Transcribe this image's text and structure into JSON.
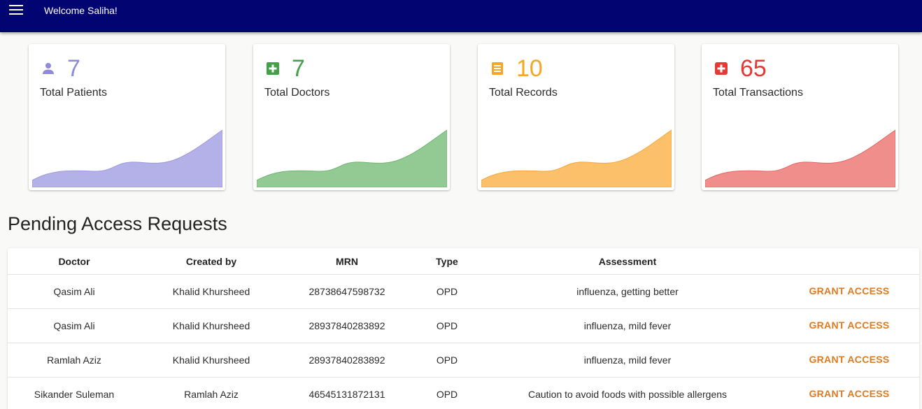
{
  "header": {
    "welcome": "Welcome Saliha!",
    "menu_icon": "hamburger-menu-icon",
    "background": "#020471"
  },
  "stats": [
    {
      "count": "7",
      "label": "Total Patients",
      "icon": "person-icon",
      "color": "#8f8bd8",
      "fill": "#b4b1e8"
    },
    {
      "count": "7",
      "label": "Total Doctors",
      "icon": "plus-square-icon",
      "color": "#43a047",
      "fill": "#93c993"
    },
    {
      "count": "10",
      "label": "Total Records",
      "icon": "document-icon",
      "color": "#f5a623",
      "fill": "#fcc06a"
    },
    {
      "count": "65",
      "label": "Total Transactions",
      "icon": "first-aid-icon",
      "color": "#e53935",
      "fill": "#f08e8c"
    }
  ],
  "section": {
    "title": "Pending Access Requests"
  },
  "table": {
    "headers": [
      "Doctor",
      "Created by",
      "MRN",
      "Type",
      "Assessment"
    ],
    "action_label": "GRANT ACCESS",
    "rows": [
      {
        "doctor": "Qasim Ali",
        "created_by": "Khalid Khursheed",
        "mrn": "28738647598732",
        "type": "OPD",
        "assessment": "influenza, getting better"
      },
      {
        "doctor": "Qasim Ali",
        "created_by": "Khalid Khursheed",
        "mrn": "28937840283892",
        "type": "OPD",
        "assessment": "influenza, mild fever"
      },
      {
        "doctor": "Ramlah Aziz",
        "created_by": "Khalid Khursheed",
        "mrn": "28937840283892",
        "type": "OPD",
        "assessment": "influenza, mild fever"
      },
      {
        "doctor": "Sikander Suleman",
        "created_by": "Ramlah Aziz",
        "mrn": "46545131872131",
        "type": "OPD",
        "assessment": "Caution to avoid foods with possible allergens"
      }
    ]
  }
}
